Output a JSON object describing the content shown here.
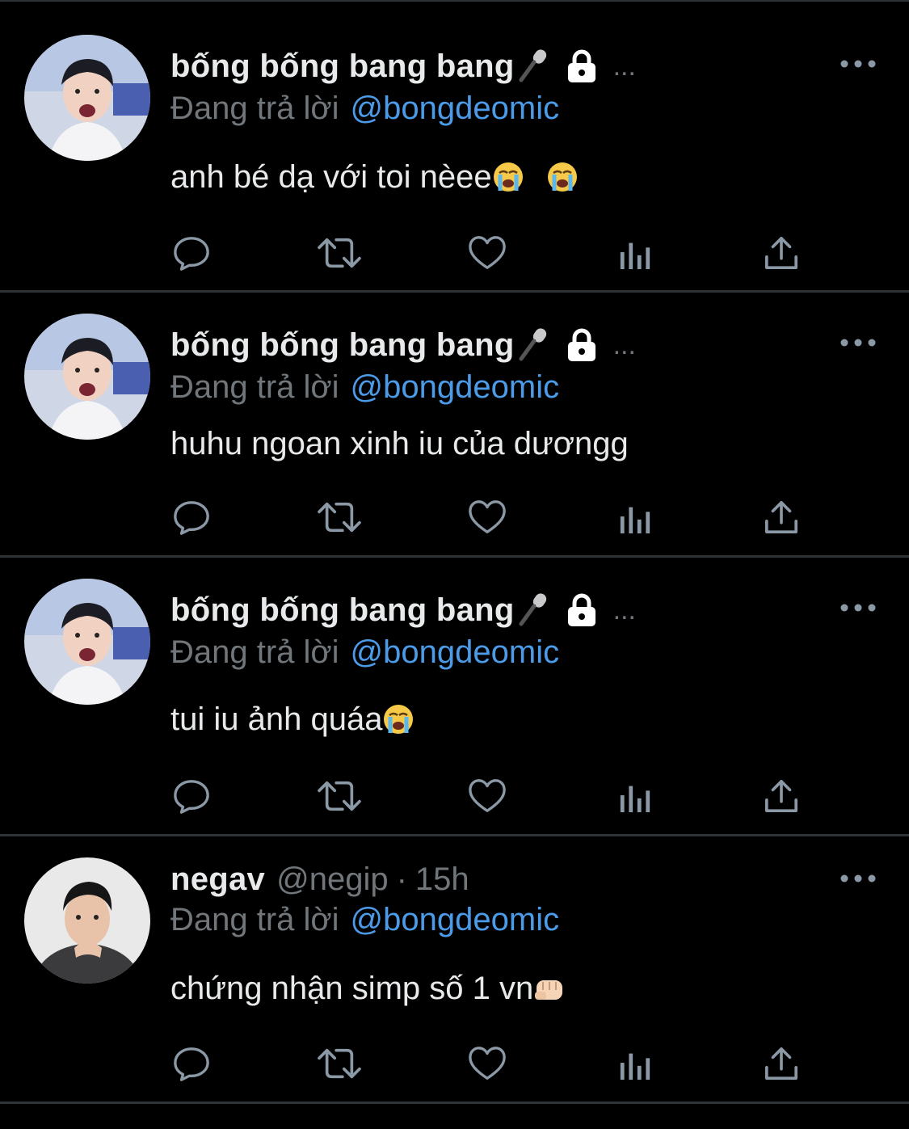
{
  "tweets": [
    {
      "display_name": "bống bống bang bang",
      "reply_prefix": "Đang trả lời",
      "reply_handle": "@bongdeomic",
      "text": "anh bé dạ với toi nèee",
      "emojis": [
        "loudly-crying-face",
        "loudly-crying-face"
      ],
      "header_icons": [
        "microphone-icon",
        "lock-icon"
      ],
      "truncation": "..."
    },
    {
      "display_name": "bống bống bang bang",
      "reply_prefix": "Đang trả lời",
      "reply_handle": "@bongdeomic",
      "text": "huhu ngoan xinh iu của dươngg",
      "emojis": [],
      "header_icons": [
        "microphone-icon",
        "lock-icon"
      ],
      "truncation": "..."
    },
    {
      "display_name": "bống bống bang bang",
      "reply_prefix": "Đang trả lời",
      "reply_handle": "@bongdeomic",
      "text": "tui iu ảnh quáa",
      "emojis": [
        "loudly-crying-face"
      ],
      "header_icons": [
        "microphone-icon",
        "lock-icon"
      ],
      "truncation": "..."
    },
    {
      "display_name": "negav",
      "handle": "@negip",
      "separator": "·",
      "time": "15h",
      "reply_prefix": "Đang trả lời",
      "reply_handle": "@bongdeomic",
      "text": "chứng nhận simp số 1 vn",
      "emojis": [
        "oncoming-fist"
      ],
      "header_icons": []
    }
  ],
  "action_icons": [
    "reply-icon",
    "retweet-icon",
    "like-icon",
    "views-icon",
    "share-icon"
  ],
  "colors": {
    "background": "#000000",
    "primary_text": "#e7e9ea",
    "secondary_text": "#71767b",
    "link": "#4c9be8",
    "divider": "#2f3336",
    "icon": "#8b98a5"
  }
}
